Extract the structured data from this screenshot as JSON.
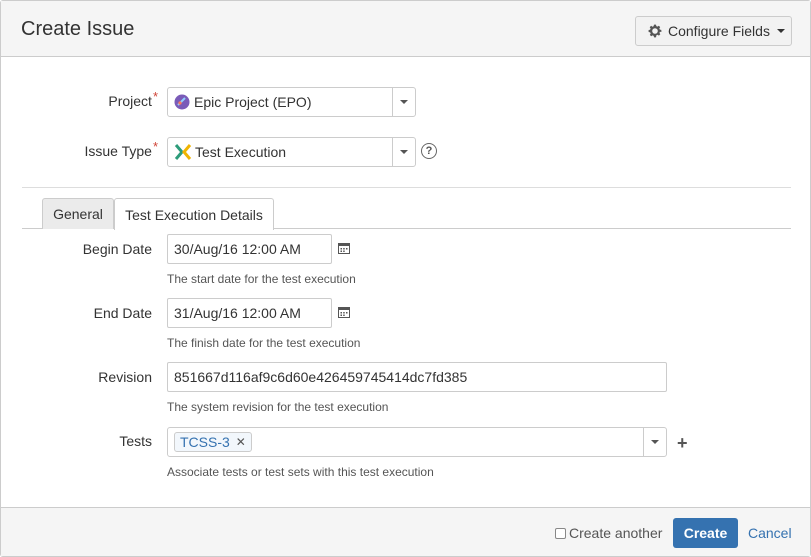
{
  "header": {
    "title": "Create Issue",
    "configure_fields_label": "Configure Fields"
  },
  "fields": {
    "project": {
      "label": "Project",
      "value": "Epic Project (EPO)"
    },
    "issue_type": {
      "label": "Issue Type",
      "value": "Test Execution"
    },
    "required_marker": "*"
  },
  "tabs": [
    {
      "label": "General",
      "active": false
    },
    {
      "label": "Test Execution Details",
      "active": true
    }
  ],
  "details": {
    "begin_date": {
      "label": "Begin Date",
      "value": "30/Aug/16 12:00 AM",
      "description": "The start date for the test execution"
    },
    "end_date": {
      "label": "End Date",
      "value": "31/Aug/16 12:00 AM",
      "description": "The finish date for the test execution"
    },
    "revision": {
      "label": "Revision",
      "value": "851667d116af9c6d60e426459745414dc7fd385",
      "description": "The system revision for the test execution"
    },
    "tests": {
      "label": "Tests",
      "tags": [
        "TCSS-3"
      ],
      "description": "Associate tests or test sets with this test execution"
    }
  },
  "footer": {
    "create_another_label": "Create another",
    "create_another_checked": false,
    "create_label": "Create",
    "cancel_label": "Cancel"
  },
  "colors": {
    "accent": "#3572b0",
    "required": "#d04437",
    "header_bg": "#f5f5f5"
  },
  "icons": {
    "configure": "gear-icon",
    "project": "project-avatar-icon",
    "issue_type": "test-execution-icon",
    "help": "help-icon",
    "date": "calendar-icon",
    "add": "plus-icon",
    "remove_tag": "close-icon"
  }
}
